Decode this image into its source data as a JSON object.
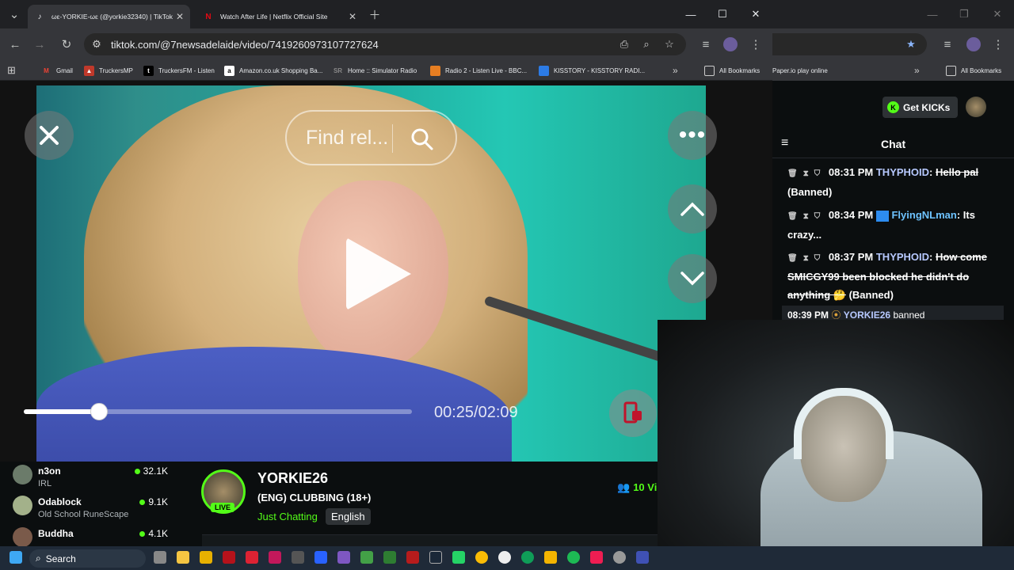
{
  "browser": {
    "tabs": [
      {
        "label": "ωԑ-YORKIE-ωԑ (@yorkie32340) | TikTok",
        "active": true
      },
      {
        "label": "Watch After Life | Netflix Official Site",
        "active": false
      }
    ],
    "url": "tiktok.com/@7newsadelaide/video/7419260973107727624",
    "bookmarks": [
      {
        "label": "Gmail",
        "icon": "gmail-icon",
        "color": "#ea4335"
      },
      {
        "label": "TruckersMP",
        "icon": "truck-icon",
        "color": "#c0392b"
      },
      {
        "label": "TruckersFM - Listen",
        "icon": "tiktok-icon",
        "color": "#000000"
      },
      {
        "label": "Amazon.co.uk Shopping Ba...",
        "icon": "amazon-icon",
        "color": "#ffffff"
      },
      {
        "label": "Home :: Simulator Radio",
        "icon": "sr-icon",
        "color": "#555555"
      },
      {
        "label": "Radio 2 - Listen Live - BBC...",
        "icon": "radio-icon",
        "color": "#e67e22"
      },
      {
        "label": "KISSTORY - KISSTORY RADI...",
        "icon": "kiss-icon",
        "color": "#2c7be5"
      }
    ],
    "all_bookmarks": "All Bookmarks",
    "right_bookmarks": [
      "Paper.io play online",
      "All Bookmarks"
    ]
  },
  "video": {
    "search_placeholder": "Find rel...",
    "time": "00:25/02:09",
    "progress": 0.19
  },
  "channels": [
    {
      "name": "n3on",
      "category": "IRL",
      "viewers": "32.1K"
    },
    {
      "name": "Odablock",
      "category": "Old School RuneScape",
      "viewers": "9.1K"
    },
    {
      "name": "Buddha",
      "category": "",
      "viewers": "4.1K"
    }
  ],
  "stream": {
    "name": "YORKIE26",
    "title": "(ENG) CLUBBING (18+)",
    "category": "Just Chatting",
    "language": "English",
    "live": "LIVE",
    "viewers": "10 Vi"
  },
  "chat": {
    "get_kicks": "Get KICKs",
    "title": "Chat",
    "messages": [
      {
        "time": "08:31 PM",
        "user": "THYPHOID",
        "text": "Hello pal",
        "suffix": "(Banned)",
        "user_color": "#b7c9ff",
        "struck": true
      },
      {
        "time": "08:34 PM",
        "user": "FlyingNLman",
        "text": "Its crazy...",
        "suffix": "",
        "user_color": "#6ec3ff",
        "struck": false
      },
      {
        "time": "08:37 PM",
        "user": "THYPHOID",
        "text": "How come SMICGY99 been blocked he didn't do anything 🤔",
        "suffix": "(Banned)",
        "user_color": "#b7c9ff",
        "struck": true
      }
    ],
    "ban_notice": {
      "time": "08:39 PM",
      "user": "YORKIE26",
      "text": "banned"
    }
  },
  "taskbar": {
    "search": "Search"
  }
}
